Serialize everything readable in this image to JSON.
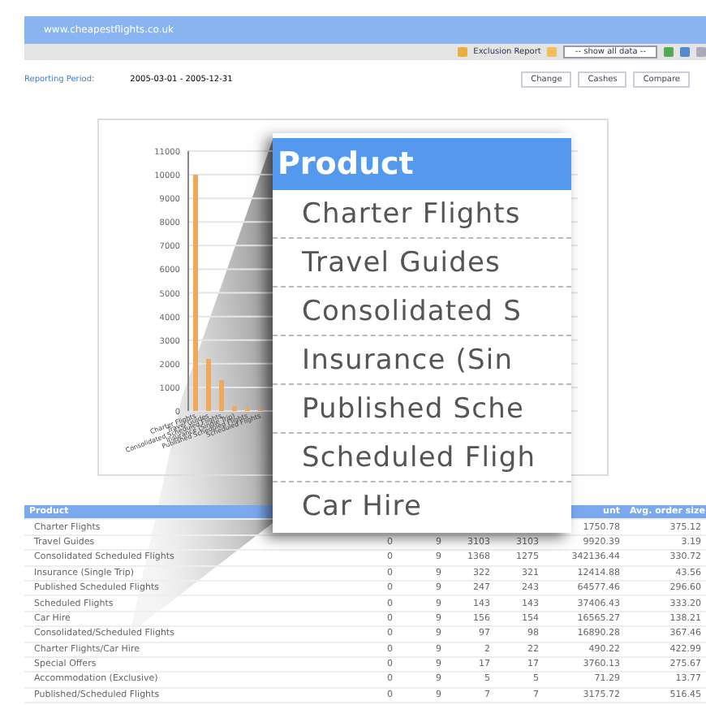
{
  "window": {
    "title": "www.cheapestflights.co.uk"
  },
  "toolbar": {
    "report": "Exclusion Report",
    "filter": "-- show all data --"
  },
  "period": {
    "label": "Reporting Period:",
    "value": "2005-03-01 - 2005-12-31"
  },
  "buttons": [
    "Change",
    "Cashes",
    "Compare"
  ],
  "chart": {
    "chart_data": {
      "type": "bar",
      "grid": true,
      "categories": [
        "Charter Flights",
        "Travel Guides",
        "Consolidated Scheduled Flights",
        "Insurance (Single Trip)",
        "Published Scheduled Flights",
        "Scheduled Flights"
      ],
      "values": [
        10000,
        2200,
        1300,
        200,
        150,
        100
      ],
      "ylim": [
        0,
        11000
      ],
      "yticks": [
        0,
        1000,
        2000,
        3000,
        4000,
        5000,
        6000,
        7000,
        8000,
        9000,
        10000,
        11000
      ]
    }
  },
  "table": {
    "columns": [
      "Product",
      null,
      null,
      null,
      null,
      "unt",
      "Avg. order size"
    ],
    "rows": [
      {
        "cells": [
          "Charter Flights",
          null,
          null,
          null,
          null,
          "1750.78",
          "375.12"
        ]
      },
      {
        "cells": [
          "Travel Guides",
          "0",
          "9",
          "3103",
          "3103",
          "9920.39",
          "3.19"
        ]
      },
      {
        "cells": [
          "Consolidated Scheduled Flights",
          "0",
          "9",
          "1368",
          "1275",
          "342136.44",
          "330.72"
        ]
      },
      {
        "cells": [
          "Insurance (Single Trip)",
          "0",
          "9",
          "322",
          "321",
          "12414.88",
          "43.56"
        ]
      },
      {
        "cells": [
          "Published Scheduled Flights",
          "0",
          "9",
          "247",
          "243",
          "64577.46",
          "296.60"
        ]
      },
      {
        "cells": [
          "Scheduled Flights",
          "0",
          "9",
          "143",
          "143",
          "37406.43",
          "333.20"
        ]
      },
      {
        "cells": [
          "Car Hire",
          "0",
          "9",
          "156",
          "154",
          "16565.27",
          "138.21"
        ]
      },
      {
        "cells": [
          "Consolidated/Scheduled Flights",
          "0",
          "9",
          "97",
          "98",
          "16890.28",
          "367.46"
        ]
      },
      {
        "cells": [
          "Charter Flights/Car Hire",
          "0",
          "9",
          "2",
          "22",
          "490.22",
          "422.99"
        ]
      },
      {
        "cells": [
          "Special Offers",
          "0",
          "9",
          "17",
          "17",
          "3760.13",
          "275.67"
        ]
      },
      {
        "cells": [
          "Accommodation (Exclusive)",
          "0",
          "9",
          "5",
          "5",
          "71.29",
          "13.77"
        ]
      },
      {
        "cells": [
          "Published/Scheduled Flights",
          "0",
          "9",
          "7",
          "7",
          "3175.72",
          "516.45"
        ]
      }
    ]
  },
  "popup": {
    "header": "Product",
    "items": [
      "Charter Flights",
      "Travel Guides",
      "Consolidated S",
      "Insurance (Sin",
      "Published Sche",
      "Scheduled Fligh",
      "Car Hire"
    ]
  }
}
